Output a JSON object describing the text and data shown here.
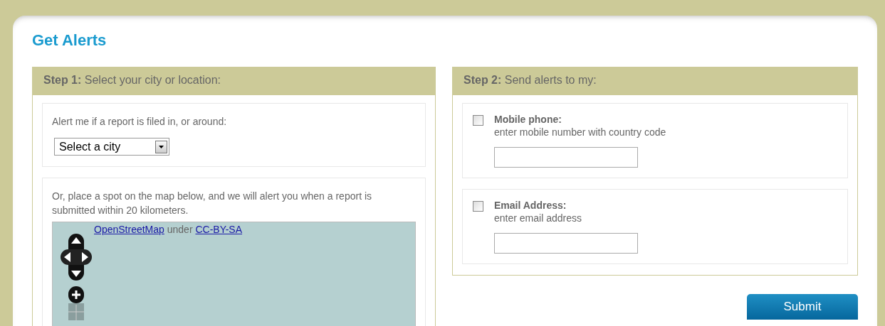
{
  "page": {
    "title": "Get Alerts"
  },
  "step1": {
    "heading": "**Step 1:** Select your city or location:",
    "city_prompt": "Alert me if a report is filed in, or around:",
    "city_select": {
      "value": "Select a city"
    },
    "map_prompt": "Or, place a spot on the map below, and we will alert you when a report is submitted within 20 kilometers.",
    "map": {
      "attribution": {
        "source_link": "OpenStreetMap",
        "joiner": "under",
        "license_link": "CC-BY-SA"
      }
    }
  },
  "step2": {
    "heading": "**Step 2:** Send alerts to my:",
    "channels": [
      {
        "label": "Mobile phone:",
        "hint": "enter mobile number with country code",
        "checked": false
      },
      {
        "label": "Email Address:",
        "hint": "enter email address",
        "checked": false
      }
    ]
  },
  "submit": "Submit"
}
